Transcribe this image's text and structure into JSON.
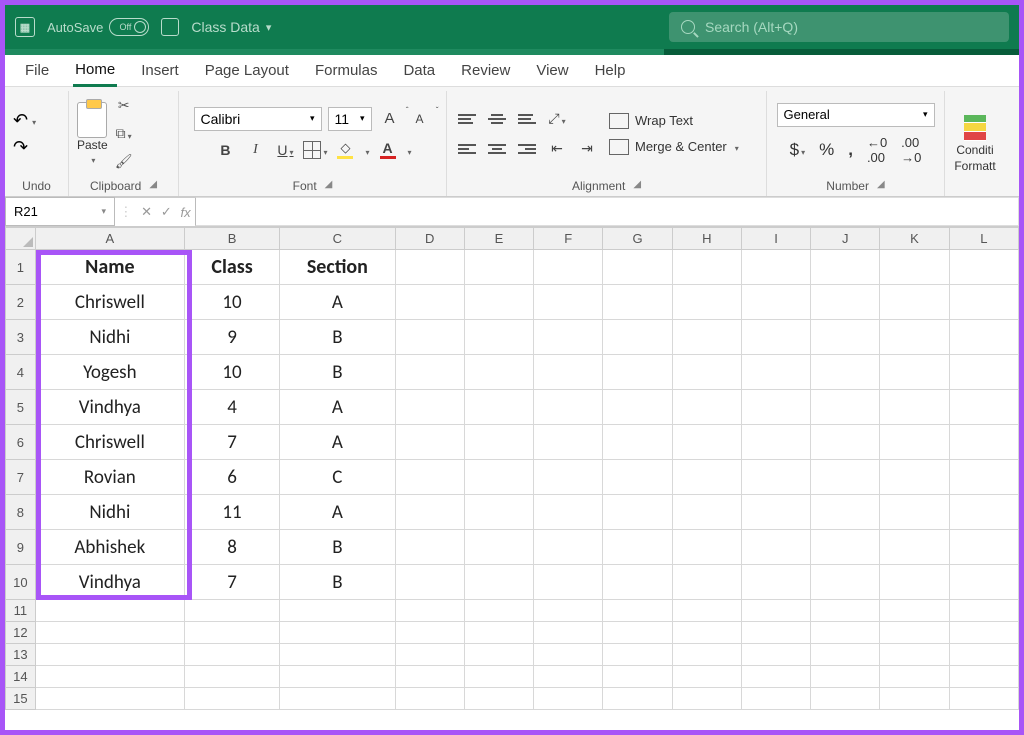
{
  "titlebar": {
    "autosave_label": "AutoSave",
    "autosave_state": "Off",
    "document_name": "Class Data",
    "search_placeholder": "Search (Alt+Q)"
  },
  "menu": {
    "file": "File",
    "home": "Home",
    "insert": "Insert",
    "page_layout": "Page Layout",
    "formulas": "Formulas",
    "data": "Data",
    "review": "Review",
    "view": "View",
    "help": "Help"
  },
  "ribbon": {
    "undo_label": "Undo",
    "clipboard_label": "Clipboard",
    "paste_label": "Paste",
    "font_label": "Font",
    "font_name": "Calibri",
    "font_size": "11",
    "alignment_label": "Alignment",
    "wrap_text_label": "Wrap Text",
    "merge_center_label": "Merge & Center",
    "number_label": "Number",
    "number_format": "General",
    "cond_format_label1": "Conditi",
    "cond_format_label2": "Formatt"
  },
  "formula_bar": {
    "name_box": "R21",
    "fx": "fx"
  },
  "columns": [
    "A",
    "B",
    "C",
    "D",
    "E",
    "F",
    "G",
    "H",
    "I",
    "J",
    "K",
    "L"
  ],
  "rows": [
    {
      "n": "1",
      "a": "Name",
      "b": "Class",
      "c": "Section"
    },
    {
      "n": "2",
      "a": "Chriswell",
      "b": "10",
      "c": "A"
    },
    {
      "n": "3",
      "a": "Nidhi",
      "b": "9",
      "c": "B"
    },
    {
      "n": "4",
      "a": "Yogesh",
      "b": "10",
      "c": "B"
    },
    {
      "n": "5",
      "a": "Vindhya",
      "b": "4",
      "c": "A"
    },
    {
      "n": "6",
      "a": "Chriswell",
      "b": "7",
      "c": "A"
    },
    {
      "n": "7",
      "a": "Rovian",
      "b": "6",
      "c": "C"
    },
    {
      "n": "8",
      "a": "Nidhi",
      "b": "11",
      "c": "A"
    },
    {
      "n": "9",
      "a": "Abhishek",
      "b": "8",
      "c": "B"
    },
    {
      "n": "10",
      "a": "Vindhya",
      "b": "7",
      "c": "B"
    },
    {
      "n": "11",
      "a": "",
      "b": "",
      "c": ""
    },
    {
      "n": "12",
      "a": "",
      "b": "",
      "c": ""
    },
    {
      "n": "13",
      "a": "",
      "b": "",
      "c": ""
    },
    {
      "n": "14",
      "a": "",
      "b": "",
      "c": ""
    },
    {
      "n": "15",
      "a": "",
      "b": "",
      "c": ""
    }
  ]
}
